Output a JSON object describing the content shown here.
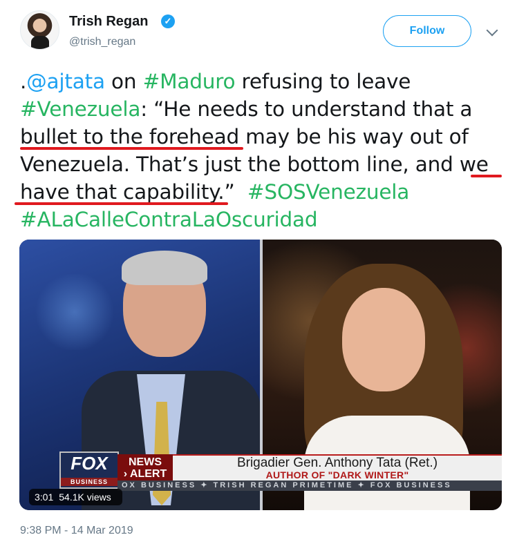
{
  "author": {
    "name": "Trish Regan",
    "handle": "@trish_regan",
    "verified_glyph": "✓"
  },
  "follow_label": "Follow",
  "tweet": {
    "line1": [
      {
        "text": ".",
        "color": "text"
      },
      {
        "text": "@ajtata",
        "color": "link"
      },
      {
        "text": " on ",
        "color": "text"
      },
      {
        "text": "#Maduro",
        "color": "hashtag"
      },
      {
        "text": " refusing to leave",
        "color": "text"
      }
    ],
    "line2": [
      {
        "text": "#Venezuela",
        "color": "hashtag"
      },
      {
        "text": ": “He needs to understand that a",
        "color": "text"
      }
    ],
    "line3": "bullet to the forehead may be his way out of",
    "line4": "Venezuela. That’s just the bottom line, and we",
    "line5a": "have that capability.”",
    "line5b": "#SOSVenezuela",
    "line6": "#ALaCalleContraLaOscuridad"
  },
  "video": {
    "network_logo": "FOX",
    "network_sub": "BUSINESS",
    "alert_line1": "NEWS",
    "alert_line2": "› ALERT",
    "guest_name": "Brigadier Gen. Anthony Tata (Ret.)",
    "guest_title": "AUTHOR OF \"DARK WINTER\"",
    "ticker": "OX BUSINESS  ✦  TRISH REGAN PRIMETIME  ✦  FOX BUSINESS",
    "duration": "3:01",
    "views": "54.1K views"
  },
  "timestamp": "9:38 PM - 14 Mar 2019",
  "colors": {
    "link": "#1da1f2",
    "hashtag": "#27b561",
    "underline": "#e0191f",
    "text": "#14171a"
  }
}
